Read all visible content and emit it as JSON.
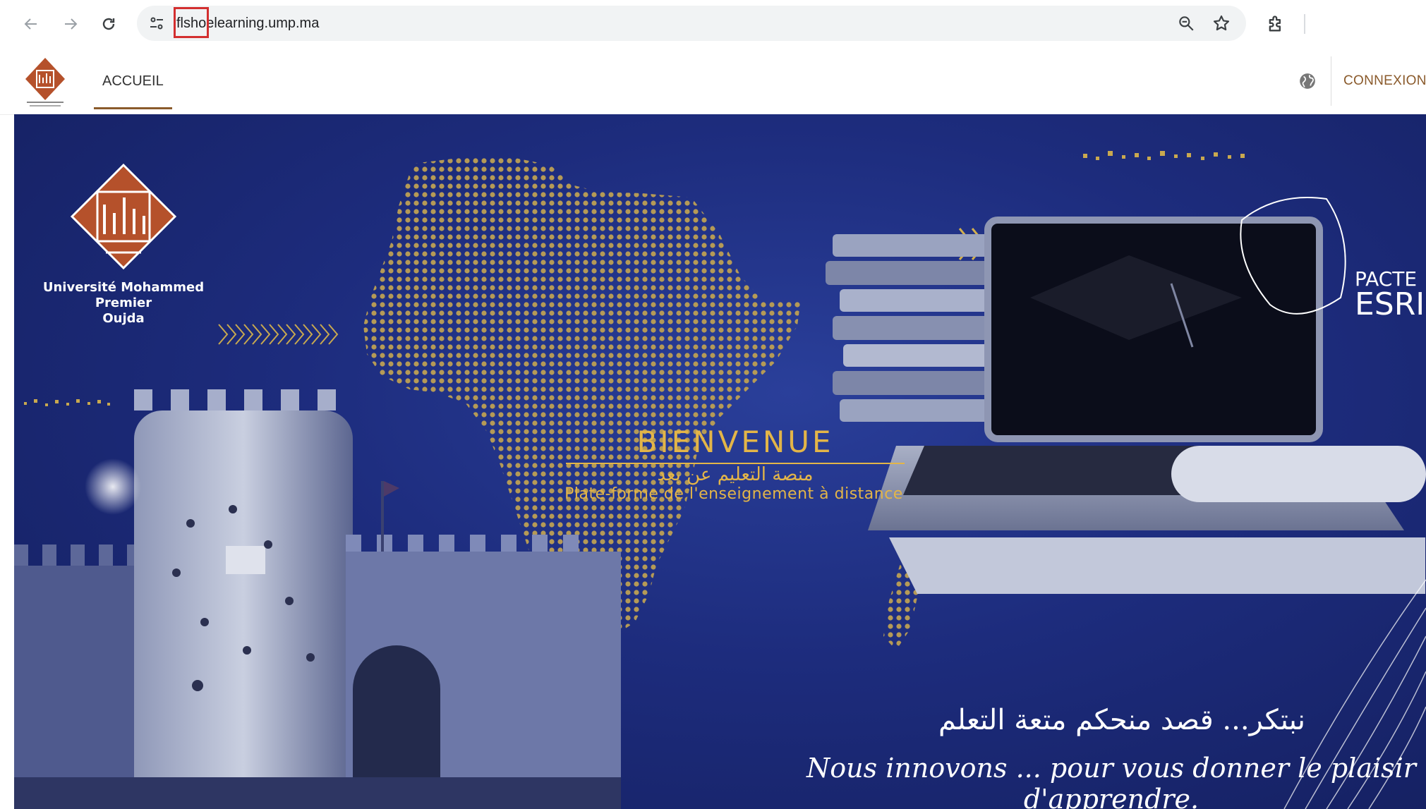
{
  "browser": {
    "url": "flshoelearning.ump.ma",
    "back_icon": "arrow-left-icon",
    "forward_icon": "arrow-right-icon",
    "reload_icon": "reload-icon",
    "site_info_icon": "tune-icon",
    "zoom_icon": "zoom-out-icon",
    "bookmark_icon": "star-icon",
    "extensions_icon": "puzzle-icon"
  },
  "header": {
    "nav": [
      "ACCUEIL"
    ],
    "login_label": "CONNEXION",
    "language_icon": "globe-icon"
  },
  "banner": {
    "university_line1": "Université Mohammed Premier",
    "university_line2": "Oujda",
    "title": "BIENVENUE",
    "subtitle_ar": "منصة التعليم عن بعد",
    "subtitle_fr": "Plate-forme de l'enseignement à distance",
    "pacte_line1": "PACTE",
    "pacte_line2": "ESRI",
    "slogan_ar": "نبتكر... قصد منحكم متعة التعلم",
    "slogan_fr": "Nous innovons ... pour vous donner le plaisir d'apprendre."
  },
  "colors": {
    "accent": "#8a5a2b",
    "banner_blue": "#1d2c7d",
    "gold": "#e3b548",
    "highlight_red": "#d32f2f"
  }
}
